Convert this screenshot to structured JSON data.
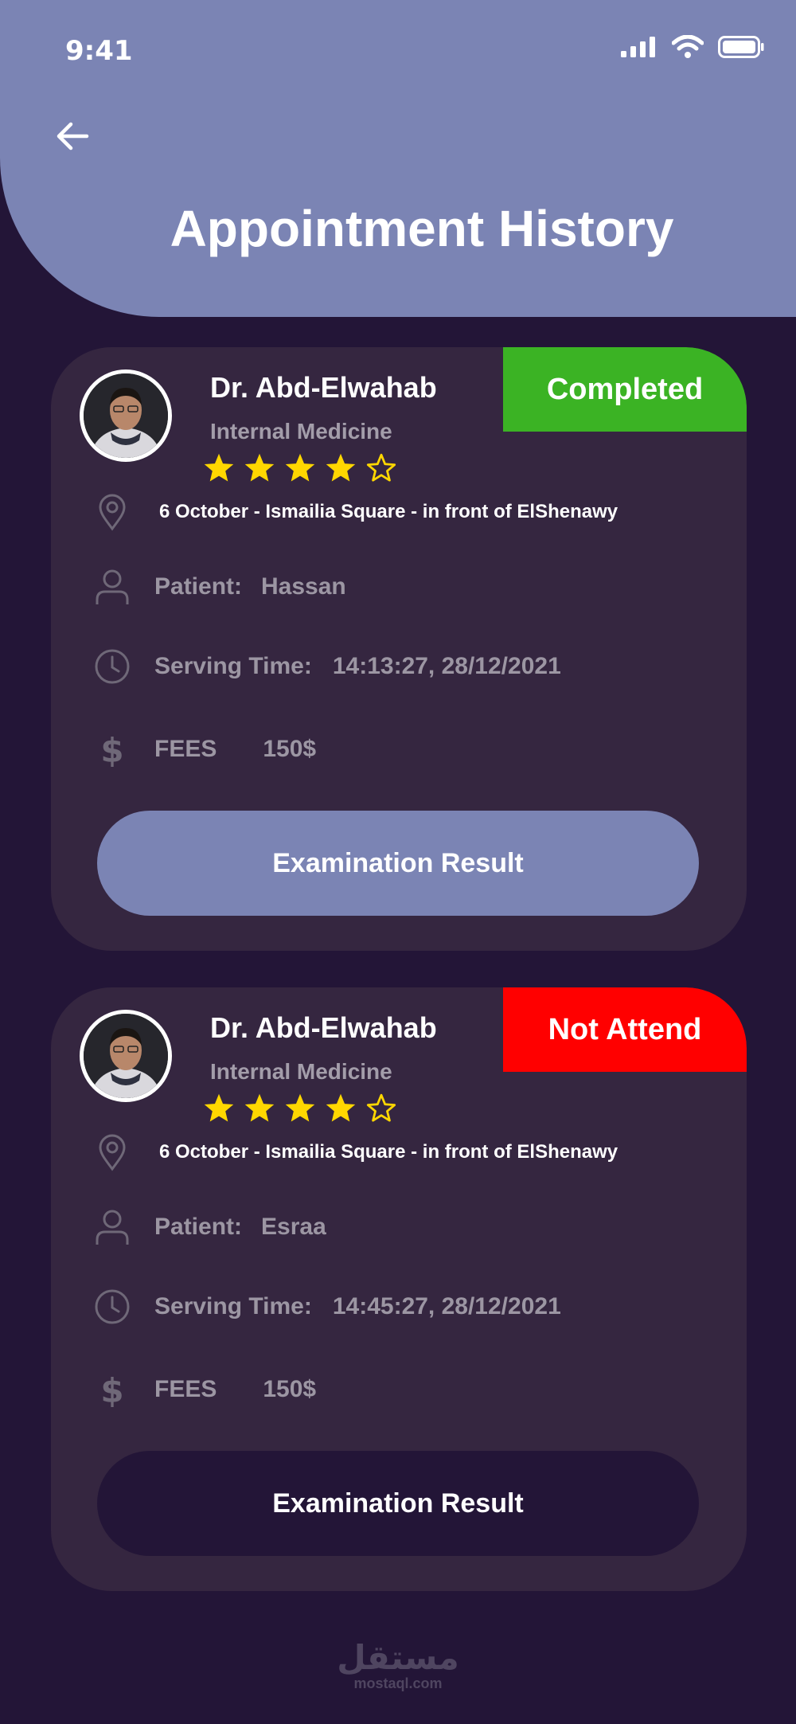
{
  "status_bar": {
    "time": "9:41"
  },
  "header": {
    "title": "Appointment History"
  },
  "appointments": [
    {
      "doctor_name": "Dr. Abd-Elwahab",
      "specialty": "Internal Medicine",
      "rating": 4,
      "rating_max": 5,
      "status": "Completed",
      "status_color": "#3bb324",
      "address": "6 October - Ismailia Square - in front of ElShenawy",
      "patient_label": "Patient:",
      "patient_name": "Hassan",
      "serving_label": "Serving Time:",
      "serving_time": "14:13:27, 28/12/2021",
      "fees_label": "FEES",
      "fees_value": "150$",
      "button_label": "Examination Result",
      "button_color": "#7b84b4"
    },
    {
      "doctor_name": "Dr. Abd-Elwahab",
      "specialty": "Internal Medicine",
      "rating": 4,
      "rating_max": 5,
      "status": "Not Attend",
      "status_color": "#ff0000",
      "address": "6 October - Ismailia Square - in front of ElShenawy",
      "patient_label": "Patient:",
      "patient_name": "Esraa",
      "serving_label": "Serving Time:",
      "serving_time": "14:45:27, 28/12/2021",
      "fees_label": "FEES",
      "fees_value": "150$",
      "button_label": "Examination Result",
      "button_color": "#231537"
    }
  ],
  "watermark": {
    "arabic": "مستقل",
    "latin": "mostaql.com"
  },
  "colors": {
    "background": "#231537",
    "header": "#7b84b4",
    "card": "#352640",
    "star": "#ffd700"
  }
}
